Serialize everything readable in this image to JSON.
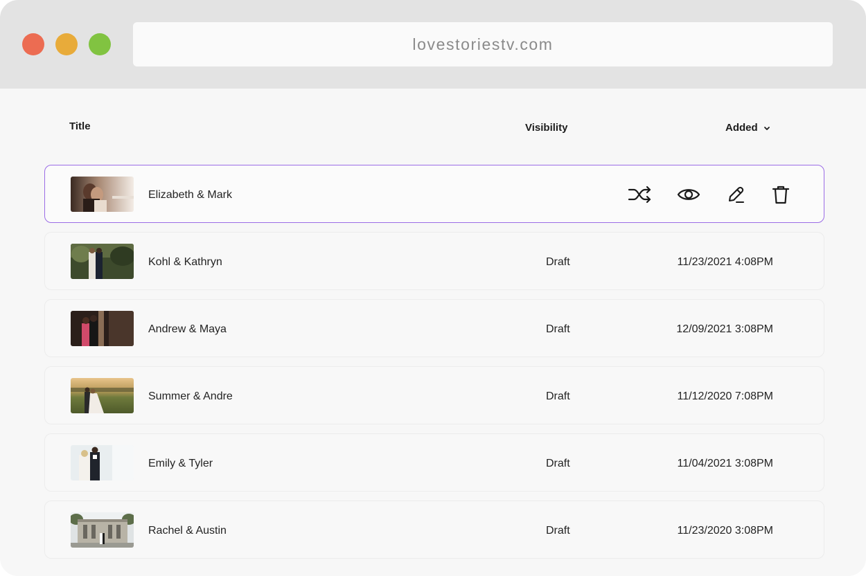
{
  "browser": {
    "url": "lovestoriestv.com"
  },
  "table": {
    "headers": {
      "title": "Title",
      "visibility": "Visibility",
      "added": "Added"
    },
    "rows": [
      {
        "title": "Elizabeth & Mark",
        "visibility": "",
        "added": "",
        "active": true
      },
      {
        "title": "Kohl & Kathryn",
        "visibility": "Draft",
        "added": "11/23/2021 4:08PM"
      },
      {
        "title": "Andrew & Maya",
        "visibility": "Draft",
        "added": "12/09/2021 3:08PM"
      },
      {
        "title": "Summer & Andre",
        "visibility": "Draft",
        "added": "11/12/2020 7:08PM"
      },
      {
        "title": "Emily & Tyler",
        "visibility": "Draft",
        "added": "11/04/2021 3:08PM"
      },
      {
        "title": "Rachel & Austin",
        "visibility": "Draft",
        "added": "11/23/2020 3:08PM"
      }
    ]
  },
  "row_actions": [
    "shuffle-icon",
    "eye-icon",
    "edit-pencil-icon",
    "trash-icon"
  ],
  "colors": {
    "active_border": "#9b6ce6",
    "close": "#ec6c52",
    "minimize": "#e8ab3a",
    "maximize": "#81c341"
  }
}
